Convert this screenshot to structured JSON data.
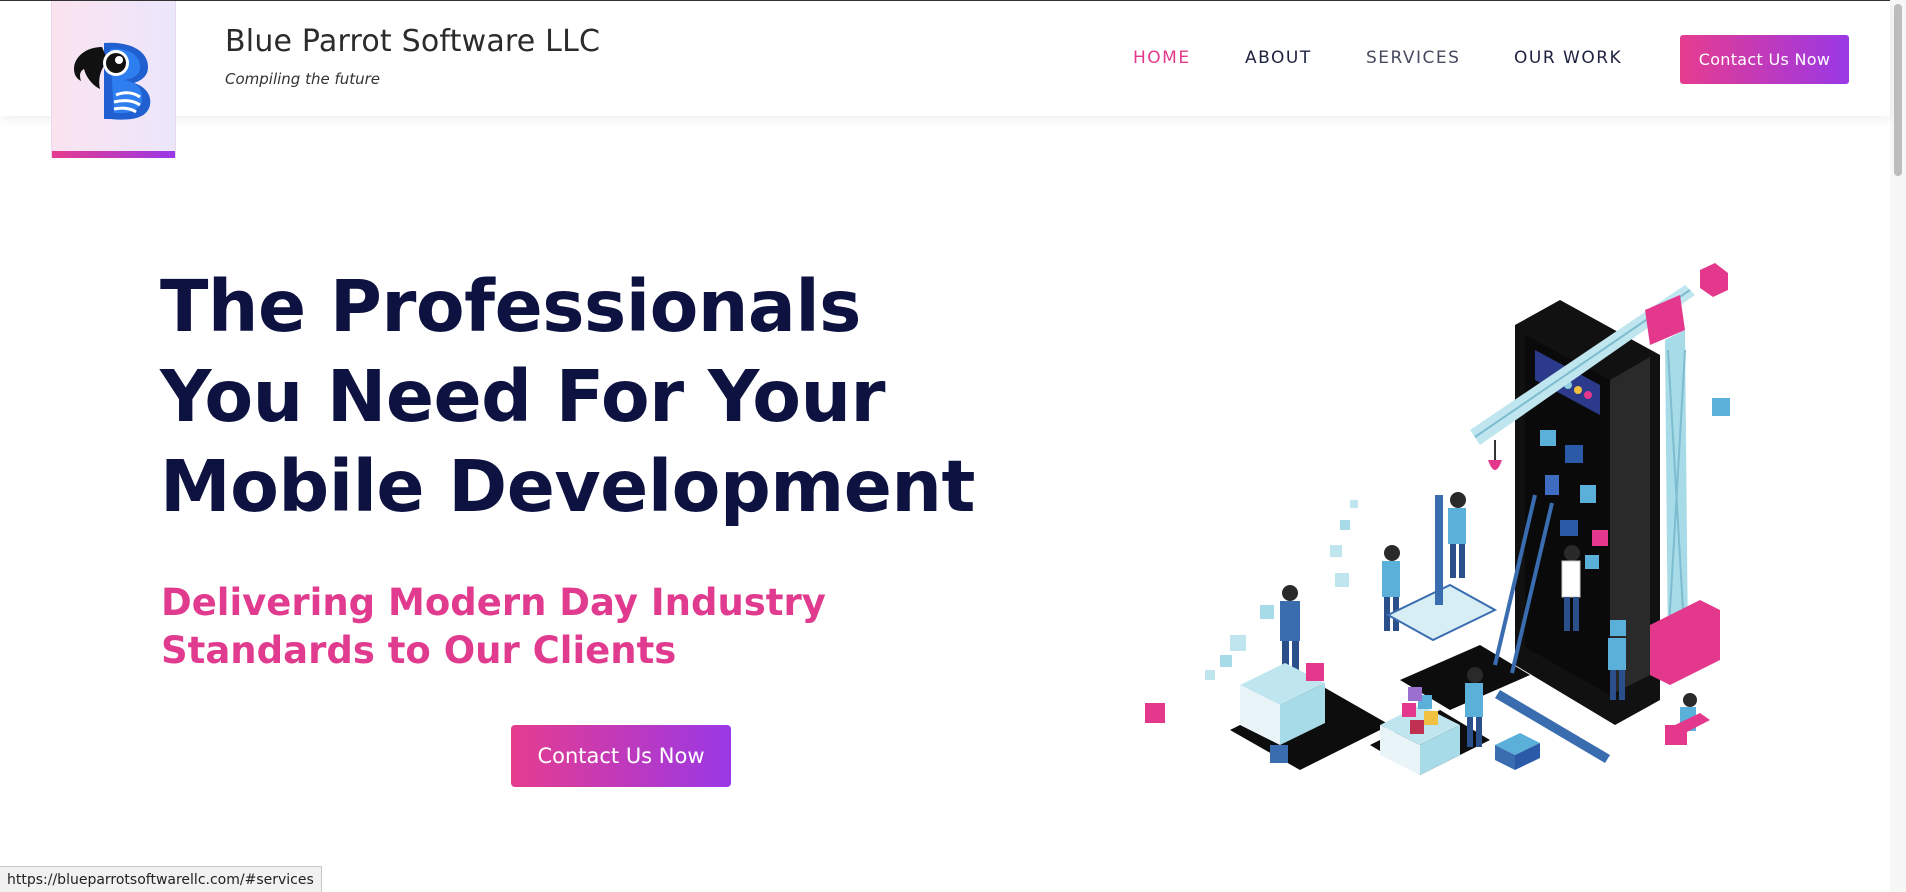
{
  "brand": {
    "name": "Blue Parrot Software LLC",
    "tagline": "Compiling the future"
  },
  "nav": {
    "items": [
      {
        "label": "HOME",
        "state": "active"
      },
      {
        "label": "ABOUT",
        "state": "normal"
      },
      {
        "label": "SERVICES",
        "state": "hover"
      },
      {
        "label": "OUR WORK",
        "state": "normal"
      }
    ],
    "cta_label": "Contact Us Now"
  },
  "hero": {
    "title_lines": [
      "The Professionals",
      "You Need For Your",
      "Mobile Development"
    ],
    "subtitle_lines": [
      "Delivering Modern Day Industry",
      "Standards to Our Clients"
    ],
    "cta_label": "Contact Us Now"
  },
  "status_bar": {
    "url": "https://blueparrotsoftwarellc.com/#services"
  },
  "colors": {
    "accent_pink": "#e4388d",
    "accent_purple": "#9a38e6",
    "heading_navy": "#0d1240",
    "nav_text": "#1d2240"
  },
  "icons": {
    "logo": "parrot-head-b-logo",
    "illustration": "isometric-mobile-app-construction"
  }
}
